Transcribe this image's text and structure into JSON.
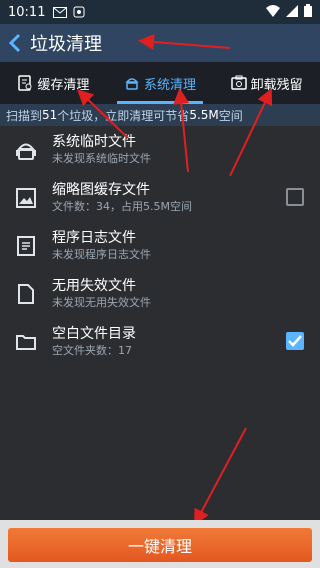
{
  "status_bar": {
    "time": "10:11"
  },
  "header": {
    "title": "垃圾清理"
  },
  "tabs": [
    {
      "label": "缓存清理",
      "icon": "cache-icon"
    },
    {
      "label": "系统清理",
      "icon": "android-icon",
      "active": true
    },
    {
      "label": "卸载残留",
      "icon": "uninstall-icon"
    }
  ],
  "scan": {
    "prefix": "扫描到",
    "count": "51",
    "mid": "个垃圾，立即清理可节省",
    "size": "5.5M",
    "suffix": "空间"
  },
  "items": [
    {
      "title": "系统临时文件",
      "sub": "未发现系统临时文件",
      "icon": "android-icon",
      "checked": null
    },
    {
      "title": "缩略图缓存文件",
      "sub": "文件数：34，占用5.5M空间",
      "icon": "image-icon",
      "checked": false
    },
    {
      "title": "程序日志文件",
      "sub": "未发现程序日志文件",
      "icon": "log-file-icon",
      "checked": null
    },
    {
      "title": "无用失效文件",
      "sub": "未发现无用失效文件",
      "icon": "file-icon",
      "checked": null
    },
    {
      "title": "空白文件目录",
      "sub": "空文件夹数：17",
      "icon": "folder-icon",
      "checked": true
    }
  ],
  "clean_button": {
    "label": "一键清理"
  },
  "colors": {
    "accent": "#5ab4ff",
    "button": "#e3581f",
    "annotation": "#e02020"
  }
}
